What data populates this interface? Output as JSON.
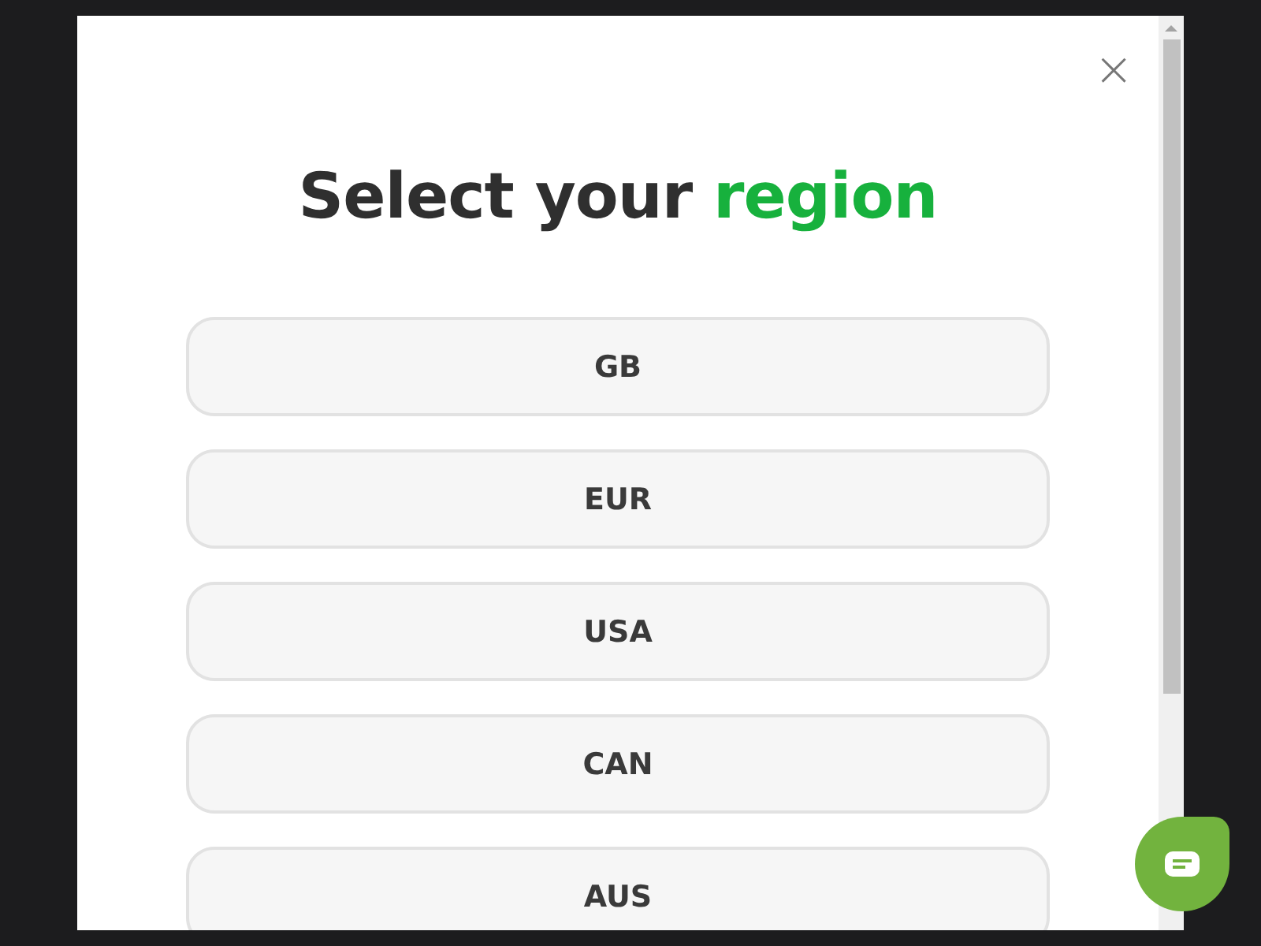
{
  "dialog": {
    "close_label": "×",
    "title": {
      "text": "Select your",
      "highlight": "region"
    },
    "regions": [
      {
        "label": "GB"
      },
      {
        "label": "EUR"
      },
      {
        "label": "USA"
      },
      {
        "label": "CAN"
      },
      {
        "label": "AUS"
      }
    ]
  }
}
